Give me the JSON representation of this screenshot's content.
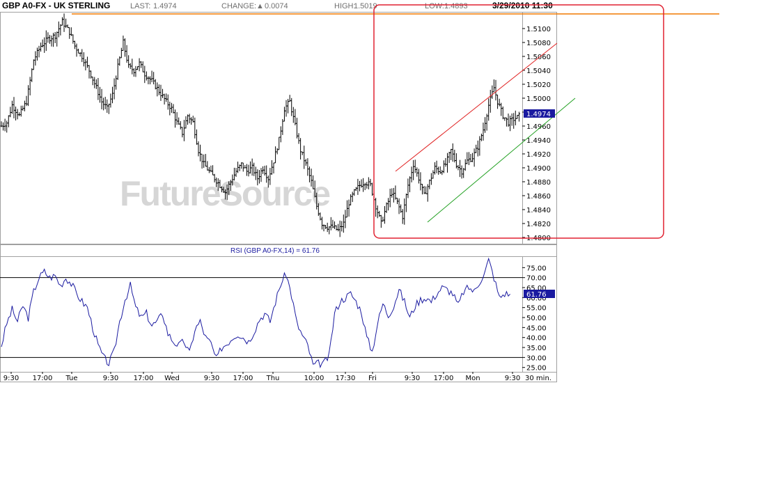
{
  "header": {
    "symbol": "GBP A0-FX - UK STERLING",
    "last_label": "LAST:",
    "last_value": "1.4974",
    "change_label": "CHANGE:",
    "change_arrow": "▲",
    "change_value": "0.0074",
    "high_label": "HIGH:",
    "high_value": "1.5019",
    "low_label": "LOW:",
    "low_value": "1.4893",
    "datetime": "3/29/2010 11:30"
  },
  "watermark": "FutureSource",
  "colors": {
    "price_bars": "#000000",
    "rsi_line": "#1a1aa0",
    "channel_upper": "#e02020",
    "channel_lower": "#20a020",
    "horizontal_line": "#f07800",
    "highlight_box": "#e02030",
    "price_box_bg": "#1a1aa0"
  },
  "chart_data": [
    {
      "type": "candlestick",
      "title": "GBP A0-FX - UK STERLING",
      "interval": "30 min.",
      "y_ticks": [
        "1.4800",
        "1.4820",
        "1.4840",
        "1.4860",
        "1.4880",
        "1.4900",
        "1.4920",
        "1.4940",
        "1.4960",
        "1.4980",
        "1.5000",
        "1.5020",
        "1.5040",
        "1.5060",
        "1.5080",
        "1.5100"
      ],
      "ylim": [
        1.48,
        1.5115
      ],
      "current_price_label": "1.4974",
      "x_ticks": [
        "9:30",
        "17:00",
        "Tue",
        "9:30",
        "17:00",
        "Wed",
        "9:30",
        "17:00",
        "Thu",
        "10:00",
        "17:30",
        "Fri",
        "9:30",
        "17:00",
        "Mon",
        "9:30",
        "30 min."
      ],
      "close_path": [
        [
          0,
          1.496
        ],
        [
          3,
          1.4965
        ],
        [
          6,
          1.499
        ],
        [
          10,
          1.4975
        ],
        [
          14,
          1.4995
        ],
        [
          18,
          1.5055
        ],
        [
          22,
          1.5075
        ],
        [
          26,
          1.5085
        ],
        [
          30,
          1.509
        ],
        [
          34,
          1.511
        ],
        [
          38,
          1.5095
        ],
        [
          41,
          1.5075
        ],
        [
          45,
          1.506
        ],
        [
          49,
          1.504
        ],
        [
          53,
          1.5015
        ],
        [
          56,
          1.4995
        ],
        [
          59,
          1.4985
        ],
        [
          62,
          1.5005
        ],
        [
          65,
          1.5045
        ],
        [
          68,
          1.508
        ],
        [
          71,
          1.5045
        ],
        [
          74,
          1.504
        ],
        [
          77,
          1.505
        ],
        [
          80,
          1.5035
        ],
        [
          84,
          1.5025
        ],
        [
          88,
          1.501
        ],
        [
          92,
          1.4995
        ],
        [
          95,
          1.4985
        ],
        [
          98,
          1.4965
        ],
        [
          101,
          1.495
        ],
        [
          104,
          1.4975
        ],
        [
          107,
          1.4965
        ],
        [
          110,
          1.4925
        ],
        [
          113,
          1.4905
        ],
        [
          116,
          1.4895
        ],
        [
          119,
          1.4885
        ],
        [
          122,
          1.4875
        ],
        [
          125,
          1.4865
        ],
        [
          128,
          1.488
        ],
        [
          131,
          1.4895
        ],
        [
          134,
          1.4905
        ],
        [
          137,
          1.4895
        ],
        [
          140,
          1.49
        ],
        [
          143,
          1.4885
        ],
        [
          146,
          1.49
        ],
        [
          149,
          1.4885
        ],
        [
          152,
          1.491
        ],
        [
          155,
          1.494
        ],
        [
          158,
          1.4985
        ],
        [
          161,
          1.4995
        ],
        [
          164,
          1.496
        ],
        [
          167,
          1.4925
        ],
        [
          170,
          1.4905
        ],
        [
          173,
          1.488
        ],
        [
          176,
          1.4845
        ],
        [
          179,
          1.482
        ],
        [
          182,
          1.4815
        ],
        [
          185,
          1.4815
        ],
        [
          188,
          1.481
        ],
        [
          191,
          1.482
        ],
        [
          194,
          1.485
        ],
        [
          197,
          1.4865
        ],
        [
          200,
          1.4875
        ],
        [
          203,
          1.488
        ],
        [
          206,
          1.4875
        ],
        [
          209,
          1.4845
        ],
        [
          212,
          1.482
        ],
        [
          215,
          1.4845
        ],
        [
          218,
          1.4865
        ],
        [
          221,
          1.485
        ],
        [
          224,
          1.483
        ],
        [
          227,
          1.4875
        ],
        [
          230,
          1.4905
        ],
        [
          233,
          1.4885
        ],
        [
          236,
          1.486
        ],
        [
          239,
          1.488
        ],
        [
          242,
          1.49
        ],
        [
          245,
          1.4895
        ],
        [
          248,
          1.4905
        ],
        [
          251,
          1.4925
        ],
        [
          254,
          1.4905
        ],
        [
          257,
          1.4895
        ],
        [
          260,
          1.491
        ],
        [
          263,
          1.4915
        ],
        [
          266,
          1.493
        ],
        [
          269,
          1.4955
        ],
        [
          272,
          1.499
        ],
        [
          275,
          1.5015
        ],
        [
          277,
          1.4995
        ],
        [
          280,
          1.4975
        ],
        [
          283,
          1.4965
        ],
        [
          286,
          1.497
        ],
        [
          289,
          1.4974
        ]
      ]
    },
    {
      "type": "line",
      "title": "RSI (GBP A0-FX,14) = 61.76",
      "y_ticks": [
        "25.00",
        "30.00",
        "35.00",
        "40.00",
        "45.00",
        "50.00",
        "55.00",
        "60.00",
        "65.00",
        "70.00",
        "75.00"
      ],
      "ylim": [
        23.5,
        80
      ],
      "reference_lines": [
        70,
        30
      ],
      "current_value_label": "61.76",
      "series": [
        {
          "values": [
            [
              0,
              36
            ],
            [
              3,
              47
            ],
            [
              6,
              54
            ],
            [
              9,
              48
            ],
            [
              12,
              56
            ],
            [
              15,
              50
            ],
            [
              18,
              63
            ],
            [
              21,
              70
            ],
            [
              24,
              73
            ],
            [
              27,
              70
            ],
            [
              30,
              71
            ],
            [
              33,
              66
            ],
            [
              36,
              70
            ],
            [
              39,
              67
            ],
            [
              42,
              62
            ],
            [
              45,
              58
            ],
            [
              48,
              55
            ],
            [
              51,
              45
            ],
            [
              54,
              36
            ],
            [
              57,
              30
            ],
            [
              60,
              27
            ],
            [
              63,
              33
            ],
            [
              66,
              48
            ],
            [
              69,
              59
            ],
            [
              72,
              66
            ],
            [
              75,
              55
            ],
            [
              78,
              50
            ],
            [
              81,
              52
            ],
            [
              84,
              46
            ],
            [
              87,
              48
            ],
            [
              90,
              52
            ],
            [
              93,
              42
            ],
            [
              96,
              38
            ],
            [
              99,
              36
            ],
            [
              102,
              38
            ],
            [
              105,
              32
            ],
            [
              108,
              44
            ],
            [
              111,
              48
            ],
            [
              114,
              40
            ],
            [
              117,
              37
            ],
            [
              120,
              29
            ],
            [
              123,
              35
            ],
            [
              126,
              37
            ],
            [
              129,
              40
            ],
            [
              132,
              42
            ],
            [
              135,
              40
            ],
            [
              138,
              38
            ],
            [
              141,
              43
            ],
            [
              144,
              49
            ],
            [
              147,
              52
            ],
            [
              150,
              48
            ],
            [
              153,
              58
            ],
            [
              156,
              67
            ],
            [
              159,
              72
            ],
            [
              162,
              61
            ],
            [
              165,
              47
            ],
            [
              168,
              41
            ],
            [
              171,
              36
            ],
            [
              174,
              26
            ],
            [
              177,
              27
            ],
            [
              180,
              27
            ],
            [
              183,
              31
            ],
            [
              186,
              52
            ],
            [
              189,
              58
            ],
            [
              192,
              60
            ],
            [
              195,
              62
            ],
            [
              198,
              58
            ],
            [
              201,
              53
            ],
            [
              204,
              40
            ],
            [
              207,
              33
            ],
            [
              210,
              47
            ],
            [
              213,
              57
            ],
            [
              216,
              51
            ],
            [
              219,
              56
            ],
            [
              222,
              64
            ],
            [
              225,
              58
            ],
            [
              228,
              50
            ],
            [
              231,
              56
            ],
            [
              234,
              59
            ],
            [
              237,
              60
            ],
            [
              240,
              58
            ],
            [
              243,
              62
            ],
            [
              246,
              65
            ],
            [
              249,
              64
            ],
            [
              252,
              62
            ],
            [
              255,
              56
            ],
            [
              258,
              63
            ],
            [
              261,
              65
            ],
            [
              264,
              63
            ],
            [
              267,
              68
            ],
            [
              270,
              73
            ],
            [
              272,
              79
            ],
            [
              275,
              70
            ],
            [
              278,
              60
            ],
            [
              281,
              62
            ],
            [
              284,
              61.76
            ]
          ]
        }
      ]
    }
  ]
}
